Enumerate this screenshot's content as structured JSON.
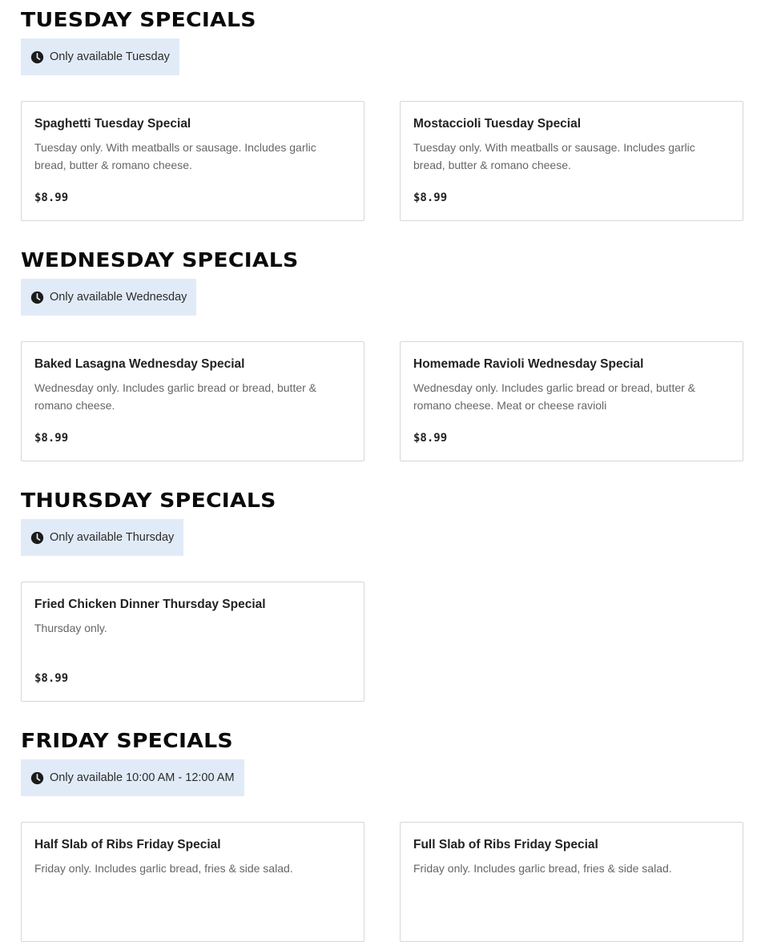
{
  "sections": [
    {
      "title": "TUESDAY SPECIALS",
      "availability": "Only available Tuesday",
      "items": [
        {
          "name": "Spaghetti Tuesday Special",
          "description": "Tuesday only. With meatballs or sausage. Includes garlic bread, butter & romano cheese.",
          "price": "$8.99"
        },
        {
          "name": "Mostaccioli Tuesday Special",
          "description": "Tuesday only. With meatballs or sausage. Includes garlic bread, butter & romano cheese.",
          "price": "$8.99"
        }
      ]
    },
    {
      "title": "WEDNESDAY SPECIALS",
      "availability": "Only available Wednesday",
      "items": [
        {
          "name": "Baked Lasagna Wednesday Special",
          "description": "Wednesday only. Includes garlic bread or bread, butter & romano cheese.",
          "price": "$8.99"
        },
        {
          "name": "Homemade Ravioli Wednesday Special",
          "description": "Wednesday only. Includes garlic bread or bread, butter & romano cheese. Meat or cheese ravioli",
          "price": "$8.99"
        }
      ]
    },
    {
      "title": "THURSDAY SPECIALS",
      "availability": "Only available Thursday",
      "items": [
        {
          "name": "Fried Chicken Dinner Thursday Special",
          "description": "Thursday only.",
          "price": "$8.99"
        }
      ]
    },
    {
      "title": "FRIDAY SPECIALS",
      "availability": "Only available 10:00 AM - 12:00 AM",
      "items": [
        {
          "name": "Half Slab of Ribs Friday Special",
          "description": "Friday only. Includes garlic bread, fries & side salad.",
          "price": ""
        },
        {
          "name": "Full Slab of Ribs Friday Special",
          "description": "Friday only. Includes garlic bread, fries & side salad.",
          "price": ""
        }
      ]
    }
  ],
  "icons": {
    "availability": "clock-icon"
  },
  "colors": {
    "badge_background": "#e1ebf8",
    "title": "#0a0a0a",
    "card_border": "#d7d7d7"
  }
}
